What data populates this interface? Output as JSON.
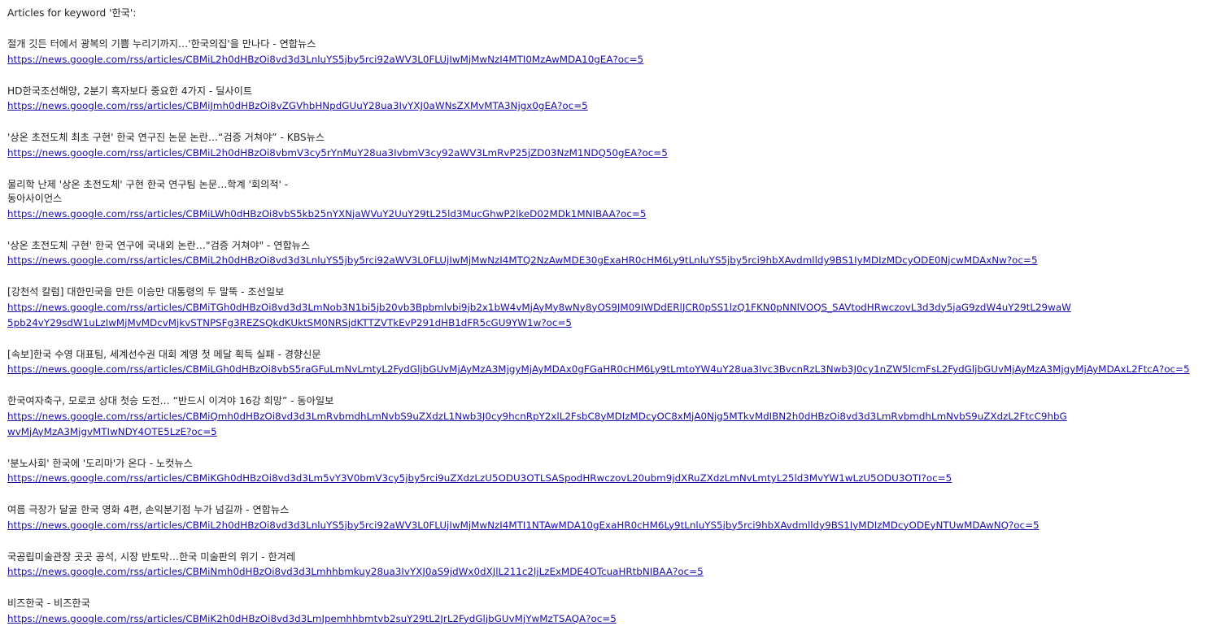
{
  "heading": "Articles for keyword '한국':",
  "articles": [
    {
      "title": "절개 깃든 터에서 광복의 기쁨 누리기까지…'한국의집'을 만나다 - 연합뉴스",
      "url": "https://news.google.com/rss/articles/CBMiL2h0dHBzOi8vd3d3LnluYS5jby5rci92aWV3L0FLUjIwMjMwNzI4MTI0MzAwMDA10gEA?oc=5"
    },
    {
      "title": "HD한국조선해양, 2분기 흑자보다 중요한 4가지 - 딜사이트",
      "url": "https://news.google.com/rss/articles/CBMiJmh0dHBzOi8vZGVhbHNpdGUuY28ua3IvYXJ0aWNsZXMvMTA3Njgx0gEA?oc=5"
    },
    {
      "title": "'상온 초전도체 최초 구현' 한국 연구진 논문 논란…“검증 거쳐야” - KBS뉴스",
      "url": "https://news.google.com/rss/articles/CBMiL2h0dHBzOi8vbmV3cy5rYnMuY28ua3IvbmV3cy92aWV3LmRvP25jZD03NzM1NDQ50gEA?oc=5"
    },
    {
      "title": "물리학 난제 '상온 초전도체' 구현 한국 연구팀 논문…학계 '회의적' -",
      "title2": "동아사이언스",
      "url": "https://news.google.com/rss/articles/CBMiLWh0dHBzOi8vbS5kb25nYXNjaWVuY2UuY29tL25ld3MucGhwP2lkeD02MDk1MNIBAA?oc=5"
    },
    {
      "title": "'상온 초전도체 구현' 한국 연구에 국내외 논란…\"검증 거쳐야\" - 연합뉴스",
      "url": "https://news.google.com/rss/articles/CBMiL2h0dHBzOi8vd3d3LnluYS5jby5rci92aWV3L0FLUjIwMjMwNzI4MTQ2NzAwMDE30gExaHR0cHM6Ly9tLnluYS5jby5rci9hbXAvdmlldy9BS1IyMDIzMDcyODE0NjcwMDAxNw?oc=5"
    },
    {
      "title": "[강천석 칼럼] 대한민국을 만든 이승만 대통령의 두 말뚝 - 조선일보",
      "url": "https://news.google.com/rss/articles/CBMiTGh0dHBzOi8vd3d3LmNob3N1bi5jb20vb3Bpbmlvbi9jb2x1bW4vMjAyMy8wNy8yOS9JM09IWDdERlJCR0pSS1lzQ1FKN0pNNlVOQS_SAVtodHRwczovL3d3dy5jaG9zdW4uY29tL29waW5pb24vY29sdW1uLzIwMjMvMDcvMjkvSTNPSFg3REZSQkdKUktSM0NRSjdKTTZVTkEvP291dHB1dFR5cGU9YW1w?oc=5"
    },
    {
      "title": "[속보]한국 수영 대표팀, 세계선수권 대회 계영 첫 메달 획득 실패 - 경향신문",
      "url": "https://news.google.com/rss/articles/CBMiLGh0dHBzOi8vbS5raGFuLmNvLmtyL2FydGljbGUvMjAyMzA3MjgyMjAyMDAx0gFGaHR0cHM6Ly9tLmtoYW4uY28ua3Ivc3BvcnRzL3Nwb3J0cy1nZW5lcmFsL2FydGljbGUvMjAyMzA3MjgyMjAyMDAxL2FtcA?oc=5"
    },
    {
      "title": "한국여자축구, 모로코 상대 첫승 도전… “반드시 이겨야 16강 희망” - 동아일보",
      "url": "https://news.google.com/rss/articles/CBMiQmh0dHBzOi8vd3d3LmRvbmdhLmNvbS9uZXdzL1Nwb3J0cy9hcnRpY2xlL2FsbC8yMDIzMDcyOC8xMjA0Njg5MTkvMdIBN2h0dHBzOi8vd3d3LmRvbmdhLmNvbS9uZXdzL2FtcC9hbGwvMjAyMzA3MjgvMTIwNDY4OTE5LzE?oc=5"
    },
    {
      "title": "'분노사회' 한국에 '도리마'가 온다 - 노컷뉴스",
      "url": "https://news.google.com/rss/articles/CBMiKGh0dHBzOi8vd3d3Lm5vY3V0bmV3cy5jby5rci9uZXdzLzU5ODU3OTLSASpodHRwczovL20ubm9jdXRuZXdzLmNvLmtyL25ld3MvYW1wLzU5ODU3OTI?oc=5"
    },
    {
      "title": "여름 극장가 달굴 한국 영화 4편, 손익분기점 누가 넘길까 - 연합뉴스",
      "url": "https://news.google.com/rss/articles/CBMiL2h0dHBzOi8vd3d3LnluYS5jby5rci92aWV3L0FLUjIwMjMwNzI4MTI1NTAwMDA10gExaHR0cHM6Ly9tLnluYS5jby5rci9hbXAvdmlldy9BS1IyMDIzMDcyODEyNTUwMDAwNQ?oc=5"
    },
    {
      "title": "국공립미술관장 곳곳 공석, 시장 반토막…한국 미술판의 위기 - 한겨레",
      "url": "https://news.google.com/rss/articles/CBMiNmh0dHBzOi8vd3d3Lmhhbmkuy28ua3IvYXJ0aS9jdWx0dXJlL211c2ljLzExMDE4OTcuaHRtbNIBAA?oc=5"
    },
    {
      "title": "비즈한국 - 비즈한국",
      "url": "https://news.google.com/rss/articles/CBMiK2h0dHBzOi8vd3d3LmJpemhhbmtvb2suY29tL2JrL2FydGljbGUvMjYwMzTSAQA?oc=5"
    }
  ]
}
